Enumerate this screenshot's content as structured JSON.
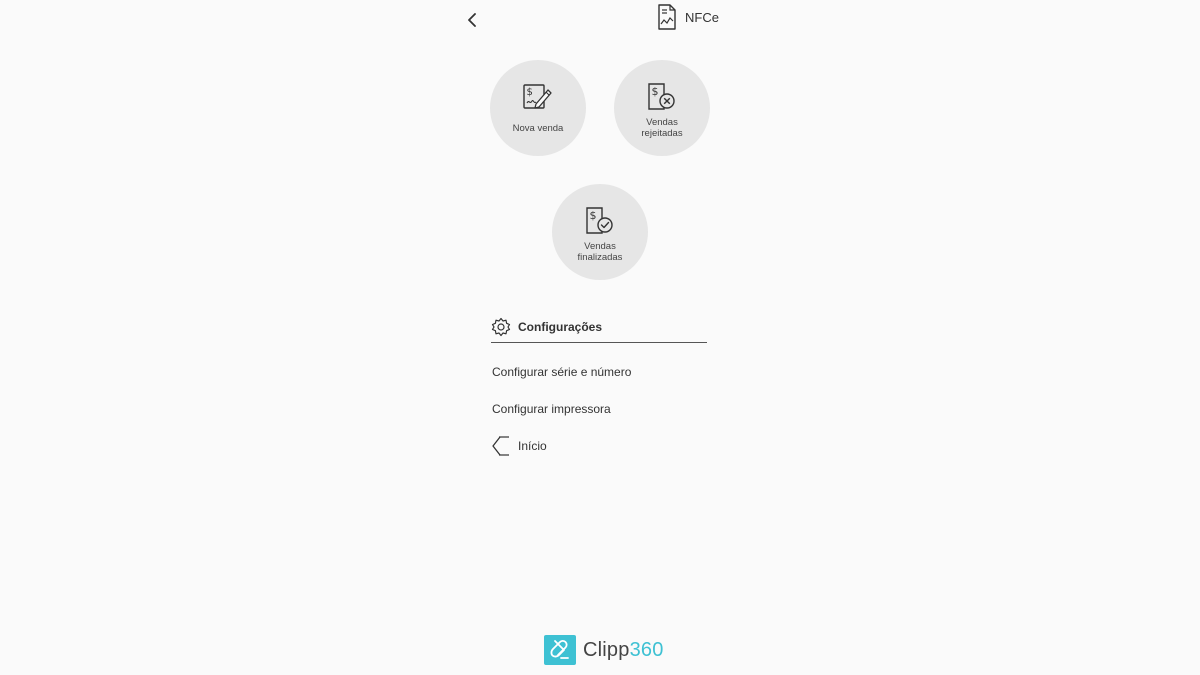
{
  "header": {
    "title": "NFCe",
    "back_icon": "chevron-left-icon",
    "title_icon": "document-chart-icon"
  },
  "actions": [
    {
      "label": "Nova venda",
      "icon": "document-dollar-pen-icon"
    },
    {
      "label": "Vendas rejeitadas",
      "icon": "document-dollar-x-icon"
    },
    {
      "label": "Vendas finalizadas",
      "icon": "document-dollar-check-icon"
    }
  ],
  "config": {
    "title": "Configurações",
    "icon": "gear-icon",
    "items": [
      {
        "label": "Configurar série e número"
      },
      {
        "label": "Configurar impressora"
      },
      {
        "label": "Início",
        "icon": "home-chevron-icon"
      }
    ]
  },
  "footer": {
    "brand_main": "Clipp",
    "brand_accent": "360",
    "logo_icon": "clipp-logo-icon",
    "colors": {
      "accent": "#3ec1d3",
      "circle_bg": "#e6e6e6"
    }
  }
}
